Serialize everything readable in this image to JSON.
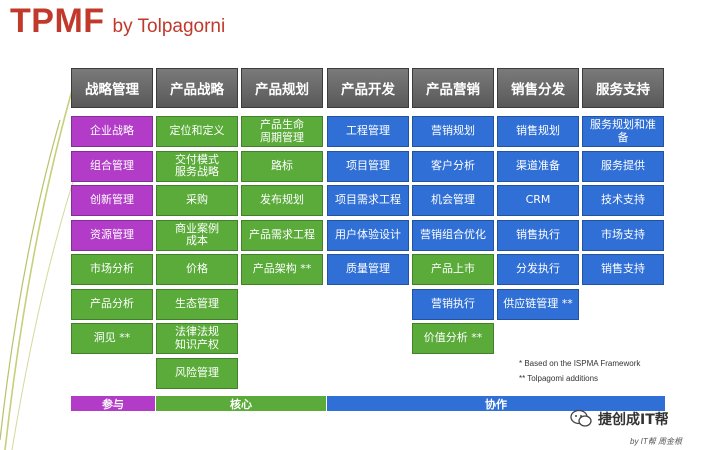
{
  "title": {
    "main": "TPMF",
    "by": "by Tolpagorni"
  },
  "columns": [
    {
      "header": "战略管理",
      "cells": [
        {
          "label": "企业战略",
          "color": "purple"
        },
        {
          "label": "组合管理",
          "color": "purple"
        },
        {
          "label": "创新管理",
          "color": "purple"
        },
        {
          "label": "资源管理",
          "color": "purple"
        },
        {
          "label": "市场分析",
          "color": "green"
        },
        {
          "label": "产品分析",
          "color": "green"
        },
        {
          "label": "洞见 **",
          "color": "green"
        }
      ]
    },
    {
      "header": "产品战略",
      "cells": [
        {
          "label": "定位和定义",
          "color": "green"
        },
        {
          "label": "交付模式\n服务战略",
          "color": "green"
        },
        {
          "label": "采购",
          "color": "green"
        },
        {
          "label": "商业案例\n成本",
          "color": "green"
        },
        {
          "label": "价格",
          "color": "green"
        },
        {
          "label": "生态管理",
          "color": "green"
        },
        {
          "label": "法律法规\n知识产权",
          "color": "green"
        },
        {
          "label": "风险管理",
          "color": "green"
        }
      ]
    },
    {
      "header": "产品规划",
      "cells": [
        {
          "label": "产品生命\n周期管理",
          "color": "green"
        },
        {
          "label": "路标",
          "color": "green"
        },
        {
          "label": "发布规划",
          "color": "green"
        },
        {
          "label": "产品需求工程",
          "color": "green"
        },
        {
          "label": "产品架构 **",
          "color": "green"
        }
      ]
    },
    {
      "header": "产品开发",
      "cells": [
        {
          "label": "工程管理",
          "color": "blue"
        },
        {
          "label": "项目管理",
          "color": "blue"
        },
        {
          "label": "项目需求工程",
          "color": "blue"
        },
        {
          "label": "用户体验设计",
          "color": "blue"
        },
        {
          "label": "质量管理",
          "color": "blue"
        }
      ]
    },
    {
      "header": "产品营销",
      "cells": [
        {
          "label": "营销规划",
          "color": "blue"
        },
        {
          "label": "客户分析",
          "color": "blue"
        },
        {
          "label": "机会管理",
          "color": "blue"
        },
        {
          "label": "营销组合优化",
          "color": "blue"
        },
        {
          "label": "产品上市",
          "color": "green"
        },
        {
          "label": "营销执行",
          "color": "blue"
        },
        {
          "label": "价值分析 **",
          "color": "green"
        }
      ]
    },
    {
      "header": "销售分发",
      "cells": [
        {
          "label": "销售规划",
          "color": "blue"
        },
        {
          "label": "渠道准备",
          "color": "blue"
        },
        {
          "label": "CRM",
          "color": "blue"
        },
        {
          "label": "销售执行",
          "color": "blue"
        },
        {
          "label": "分发执行",
          "color": "blue"
        },
        {
          "label": "供应链管理 **",
          "color": "blue"
        }
      ]
    },
    {
      "header": "服务支持",
      "cells": [
        {
          "label": "服务规划和准备",
          "color": "blue"
        },
        {
          "label": "服务提供",
          "color": "blue"
        },
        {
          "label": "技术支持",
          "color": "blue"
        },
        {
          "label": "市场支持",
          "color": "blue"
        },
        {
          "label": "销售支持",
          "color": "blue"
        }
      ]
    }
  ],
  "bars": [
    {
      "label": "参与",
      "color": "purple"
    },
    {
      "label": "核心",
      "color": "green"
    },
    {
      "label": "协作",
      "color": "blue"
    }
  ],
  "notes": [
    "* Based on the ISPMA Framework",
    "** Tolpagomi additions"
  ],
  "brand": {
    "text": "捷创成IT帮",
    "byline": "by IT帮 周金根"
  },
  "colors": {
    "purple": "#b23cc8",
    "green": "#5aab3a",
    "blue": "#2f6fd6",
    "title": "#c0392b",
    "header": "#666666"
  }
}
